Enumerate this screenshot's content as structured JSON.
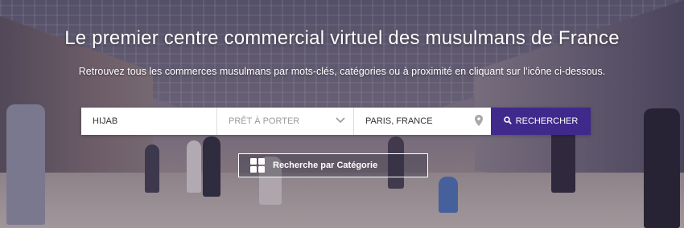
{
  "hero": {
    "headline": "Le premier centre commercial virtuel des musulmans de France",
    "subline": "Retrouvez tous les commerces musulmans par mots-clés, catégories ou à proximité en cliquant sur l’icône ci-dessous."
  },
  "search": {
    "keyword_value": "HIJAB",
    "category_placeholder": "PRÊT À PORTER",
    "location_value": "PARIS, FRANCE",
    "button_label": "RECHERCHER"
  },
  "category_button": {
    "label": "Recherche par Catégorie"
  },
  "colors": {
    "accent": "#3f2a8c",
    "text_on_image": "#ffffff"
  },
  "icons": {
    "category": "chevron-down-icon",
    "location": "map-pin-icon",
    "search": "search-icon",
    "grid": "grid-icon"
  }
}
